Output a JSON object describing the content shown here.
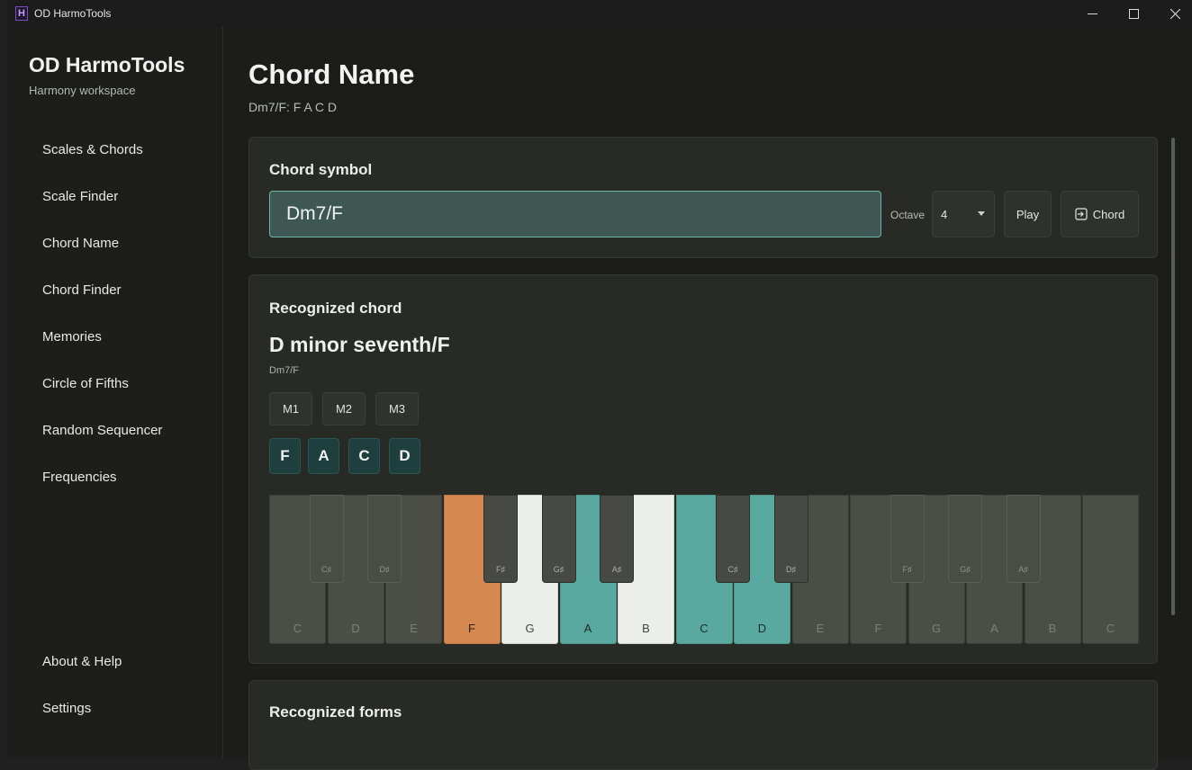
{
  "window": {
    "title": "OD HarmoTools"
  },
  "sidebar": {
    "brand": "OD HarmoTools",
    "subtitle": "Harmony workspace",
    "items": [
      {
        "label": "Scales & Chords"
      },
      {
        "label": "Scale Finder"
      },
      {
        "label": "Chord Name"
      },
      {
        "label": "Chord Finder"
      },
      {
        "label": "Memories"
      },
      {
        "label": "Circle of Fifths"
      },
      {
        "label": "Random Sequencer"
      },
      {
        "label": "Frequencies"
      }
    ],
    "footer_items": [
      {
        "label": "About & Help"
      },
      {
        "label": "Settings"
      }
    ]
  },
  "page": {
    "title": "Chord Name",
    "subtitle": "Dm7/F: F A C D"
  },
  "chord_symbol_card": {
    "title": "Chord symbol",
    "input_value": "Dm7/F",
    "octave_label": "Octave",
    "octave_value": "4",
    "play_label": "Play",
    "chord_label": "Chord",
    "chord_icon": "arrow-into-box-icon"
  },
  "recognized_card": {
    "title": "Recognized chord",
    "name": "D minor seventh/F",
    "symbol": "Dm7/F",
    "memory_buttons": [
      "M1",
      "M2",
      "M3"
    ],
    "notes": [
      "F",
      "A",
      "C",
      "D"
    ],
    "piano": {
      "white_keys": [
        {
          "label": "C",
          "state": "off"
        },
        {
          "label": "D",
          "state": "off"
        },
        {
          "label": "E",
          "state": "off"
        },
        {
          "label": "F",
          "state": "bass"
        },
        {
          "label": "G",
          "state": "in-range"
        },
        {
          "label": "A",
          "state": "chord"
        },
        {
          "label": "B",
          "state": "in-range"
        },
        {
          "label": "C",
          "state": "chord"
        },
        {
          "label": "D",
          "state": "chord"
        },
        {
          "label": "E",
          "state": "off"
        },
        {
          "label": "F",
          "state": "off"
        },
        {
          "label": "G",
          "state": "off"
        },
        {
          "label": "A",
          "state": "off"
        },
        {
          "label": "B",
          "state": "off"
        },
        {
          "label": "C",
          "state": "off"
        }
      ],
      "black_keys": [
        {
          "label": "C♯",
          "active": false
        },
        {
          "label": "D♯",
          "active": false
        },
        {
          "label": "F♯",
          "active": true
        },
        {
          "label": "G♯",
          "active": true
        },
        {
          "label": "A♯",
          "active": true
        },
        {
          "label": "C♯",
          "active": true
        },
        {
          "label": "D♯",
          "active": true
        },
        {
          "label": "F♯",
          "active": false
        },
        {
          "label": "G♯",
          "active": false
        },
        {
          "label": "A♯",
          "active": false
        }
      ],
      "colors": {
        "bass": "#d5884f",
        "chord": "#5aa9a0",
        "in_range": "#eceeea",
        "off": "#4b4e47"
      }
    }
  },
  "forms_card": {
    "title": "Recognized forms"
  }
}
